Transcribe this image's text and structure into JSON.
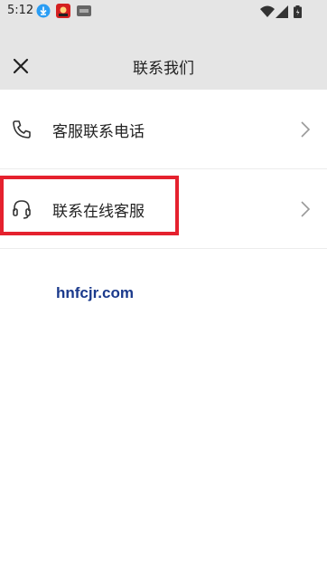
{
  "status_bar": {
    "time": "5:12",
    "icons": [
      "download-icon",
      "app-notification-icon",
      "app-badge-icon",
      "wifi-icon",
      "signal-icon",
      "battery-icon"
    ]
  },
  "header": {
    "title": "联系我们",
    "close_icon": "close-icon"
  },
  "contact_options": [
    {
      "label": "客服联系电话",
      "icon": "phone-icon"
    },
    {
      "label": "联系在线客服",
      "icon": "headset-icon"
    }
  ],
  "watermark": "hnfcjr.com",
  "colors": {
    "app_bar_bg": "#e5e5e5",
    "highlight_border": "#e5212e",
    "watermark": "#1b3a8c"
  }
}
